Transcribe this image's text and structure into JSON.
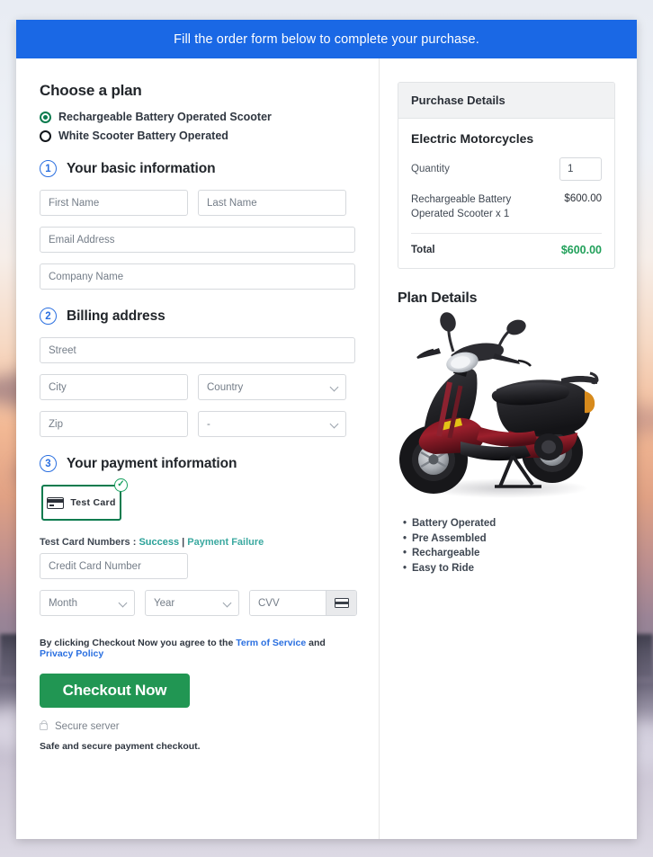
{
  "banner": {
    "text": "Fill the order form below to complete your purchase."
  },
  "plan": {
    "heading": "Choose a plan",
    "options": [
      {
        "label": "Rechargeable Battery Operated Scooter",
        "selected": true
      },
      {
        "label": "White Scooter Battery Operated",
        "selected": false
      }
    ]
  },
  "steps": {
    "basic": {
      "num": "1",
      "title": "Your basic information"
    },
    "billing": {
      "num": "2",
      "title": "Billing address"
    },
    "payment": {
      "num": "3",
      "title": "Your payment information"
    }
  },
  "fields": {
    "first_name": {
      "placeholder": "First Name",
      "value": ""
    },
    "last_name": {
      "placeholder": "Last Name",
      "value": ""
    },
    "email": {
      "placeholder": "Email Address",
      "value": ""
    },
    "company": {
      "placeholder": "Company Name",
      "value": ""
    },
    "street": {
      "placeholder": "Street",
      "value": ""
    },
    "city": {
      "placeholder": "City",
      "value": ""
    },
    "country": {
      "placeholder": "Country",
      "value": ""
    },
    "zip": {
      "placeholder": "Zip",
      "value": ""
    },
    "state": {
      "placeholder": "-",
      "value": ""
    },
    "card_number": {
      "placeholder": "Credit Card Number",
      "value": ""
    },
    "month": {
      "placeholder": "Month",
      "value": ""
    },
    "year": {
      "placeholder": "Year",
      "value": ""
    },
    "cvv": {
      "placeholder": "CVV",
      "value": ""
    }
  },
  "payment": {
    "test_card_label": "Test  Card",
    "test_numbers_prefix": "Test Card Numbers : ",
    "link_success": "Success",
    "separator": " | ",
    "link_failure": "Payment Failure"
  },
  "terms": {
    "prefix": "By clicking Checkout Now you agree to the ",
    "link_tos": "Term of Service",
    "middle": " and ",
    "link_privacy": "Privacy Policy"
  },
  "checkout": {
    "button_label": "Checkout Now",
    "secure_server": "Secure server",
    "safe_note": "Safe and secure payment checkout."
  },
  "purchase": {
    "panel_title": "Purchase Details",
    "product": "Electric Motorcycles",
    "quantity_label": "Quantity",
    "quantity_value": "1",
    "line_item_name": "Rechargeable Battery Operated Scooter x 1",
    "line_item_price": "$600.00",
    "total_label": "Total",
    "total_value": "$600.00"
  },
  "plan_details": {
    "title": "Plan Details",
    "features": [
      "Battery Operated",
      "Pre Assembled",
      "Rechargeable",
      "Easy to Ride"
    ]
  },
  "colors": {
    "banner_blue": "#1a68e5",
    "accent_green": "#219653",
    "link_blue": "#2a6fe0",
    "total_green": "#21a05a",
    "step_blue": "#2a6fe0"
  }
}
